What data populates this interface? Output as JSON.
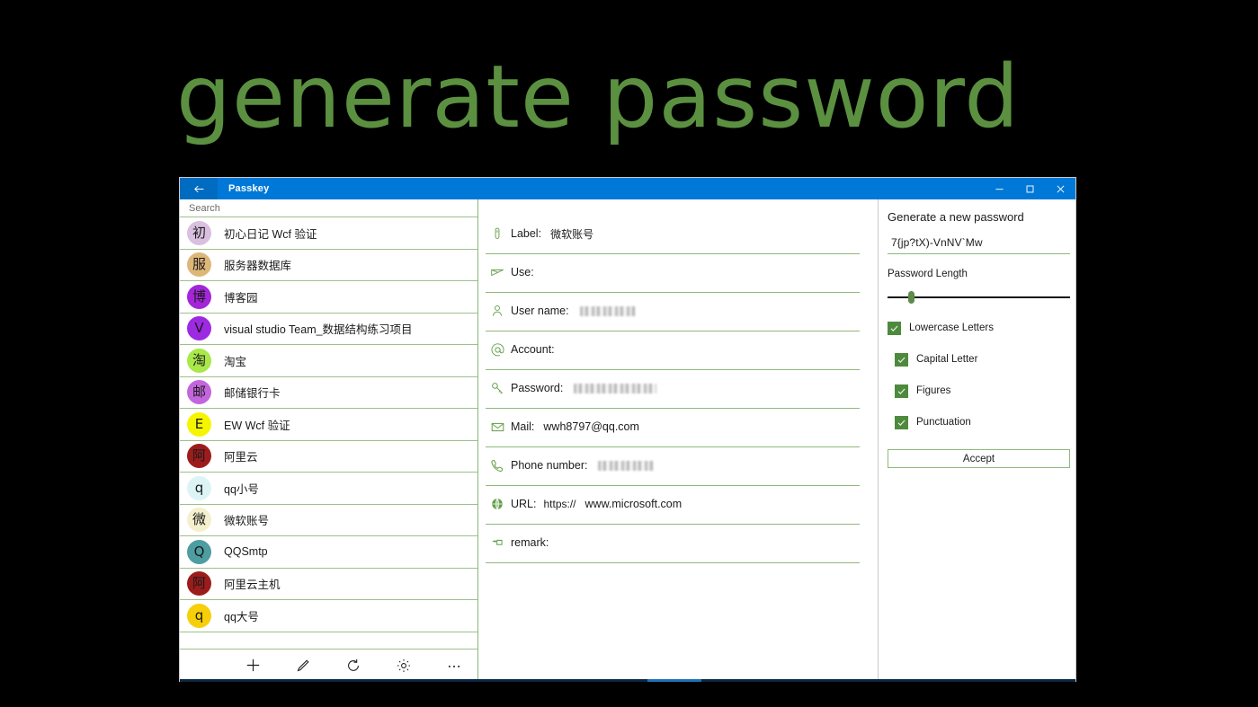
{
  "headline": "generate password",
  "window": {
    "title": "Passkey",
    "back_icon": "back-arrow-icon",
    "controls": [
      {
        "name": "minimize-button",
        "icon": "minimize-icon"
      },
      {
        "name": "restore-button",
        "icon": "restore-icon"
      },
      {
        "name": "close-button",
        "icon": "close-icon"
      }
    ]
  },
  "search": {
    "placeholder": "Search",
    "value": ""
  },
  "accounts": [
    {
      "initial": "初",
      "name": "初心日记 Wcf 验证",
      "color": "#d9bfe0"
    },
    {
      "initial": "服",
      "name": "服务器数据库",
      "color": "#ddb679"
    },
    {
      "initial": "博",
      "name": "博客园",
      "color": "#a326d9"
    },
    {
      "initial": "V",
      "name": "visual studio Team_数据结构练习项目",
      "color": "#9c2ae0"
    },
    {
      "initial": "淘",
      "name": "淘宝",
      "color": "#a8e84a"
    },
    {
      "initial": "邮",
      "name": "邮储银行卡",
      "color": "#c366dd"
    },
    {
      "initial": "E",
      "name": "EW Wcf 验证",
      "color": "#f5f500"
    },
    {
      "initial": "阿",
      "name": "阿里云",
      "color": "#9c1c1c"
    },
    {
      "initial": "q",
      "name": "qq小号",
      "color": "#ddf4f7"
    },
    {
      "initial": "微",
      "name": "微软账号",
      "color": "#f4f0cd"
    },
    {
      "initial": "Q",
      "name": "QQSmtp",
      "color": "#4e9da1"
    },
    {
      "initial": "阿",
      "name": "阿里云主机",
      "color": "#9c1c1c"
    },
    {
      "initial": "q",
      "name": "qq大号",
      "color": "#f7cf09"
    }
  ],
  "toolbar": [
    {
      "name": "add-button",
      "icon": "plus-icon"
    },
    {
      "name": "edit-button",
      "icon": "pencil-icon"
    },
    {
      "name": "refresh-button",
      "icon": "refresh-icon"
    },
    {
      "name": "settings-button",
      "icon": "gear-icon"
    },
    {
      "name": "more-button",
      "icon": "ellipsis-icon"
    }
  ],
  "form": {
    "fields": [
      {
        "key": "label",
        "icon": "paperclip-icon",
        "label": "Label:",
        "value": "微软账号",
        "cjk": true,
        "redacted": false,
        "prefix": ""
      },
      {
        "key": "use",
        "icon": "paper-plane-icon",
        "label": "Use:",
        "value": "",
        "cjk": false,
        "redacted": false,
        "prefix": ""
      },
      {
        "key": "user",
        "icon": "person-icon",
        "label": "User name:",
        "value": "",
        "cjk": false,
        "redacted": true,
        "redact_width": 62,
        "prefix": ""
      },
      {
        "key": "account",
        "icon": "at-sign-icon",
        "label": "Account:",
        "value": "",
        "cjk": false,
        "redacted": false,
        "prefix": ""
      },
      {
        "key": "password",
        "icon": "key-icon",
        "label": "Password:",
        "value": "",
        "cjk": false,
        "redacted": true,
        "redact_width": 92,
        "prefix": ""
      },
      {
        "key": "mail",
        "icon": "envelope-icon",
        "label": "Mail:",
        "value": "wwh8797@qq.com",
        "cjk": false,
        "redacted": false,
        "prefix": ""
      },
      {
        "key": "phone",
        "icon": "phone-icon",
        "label": "Phone number:",
        "value": "",
        "cjk": false,
        "redacted": true,
        "redact_width": 62,
        "prefix": ""
      },
      {
        "key": "url",
        "icon": "globe-icon",
        "label": "URL:",
        "value": "www.microsoft.com",
        "cjk": false,
        "redacted": false,
        "prefix": "https://"
      },
      {
        "key": "remark",
        "icon": "pushpin-icon",
        "label": "remark:",
        "value": "",
        "cjk": false,
        "redacted": false,
        "prefix": ""
      }
    ]
  },
  "generator": {
    "title": "Generate a new password",
    "generated_password": "7{jp?tX)-VnNV`Mw",
    "length_label": "Password Length",
    "slider_percent": 13,
    "options": [
      {
        "label": "Lowercase Letters",
        "checked": true,
        "indent": false
      },
      {
        "label": "Capital Letter",
        "checked": true,
        "indent": true
      },
      {
        "label": "Figures",
        "checked": true,
        "indent": true
      },
      {
        "label": "Punctuation",
        "checked": true,
        "indent": true
      }
    ],
    "accept_label": "Accept"
  },
  "colors": {
    "accent_green": "#5b9040",
    "titlebar_blue": "#0078d7",
    "field_line": "#8fb87c",
    "checkbox_green": "#4e8a3d"
  }
}
